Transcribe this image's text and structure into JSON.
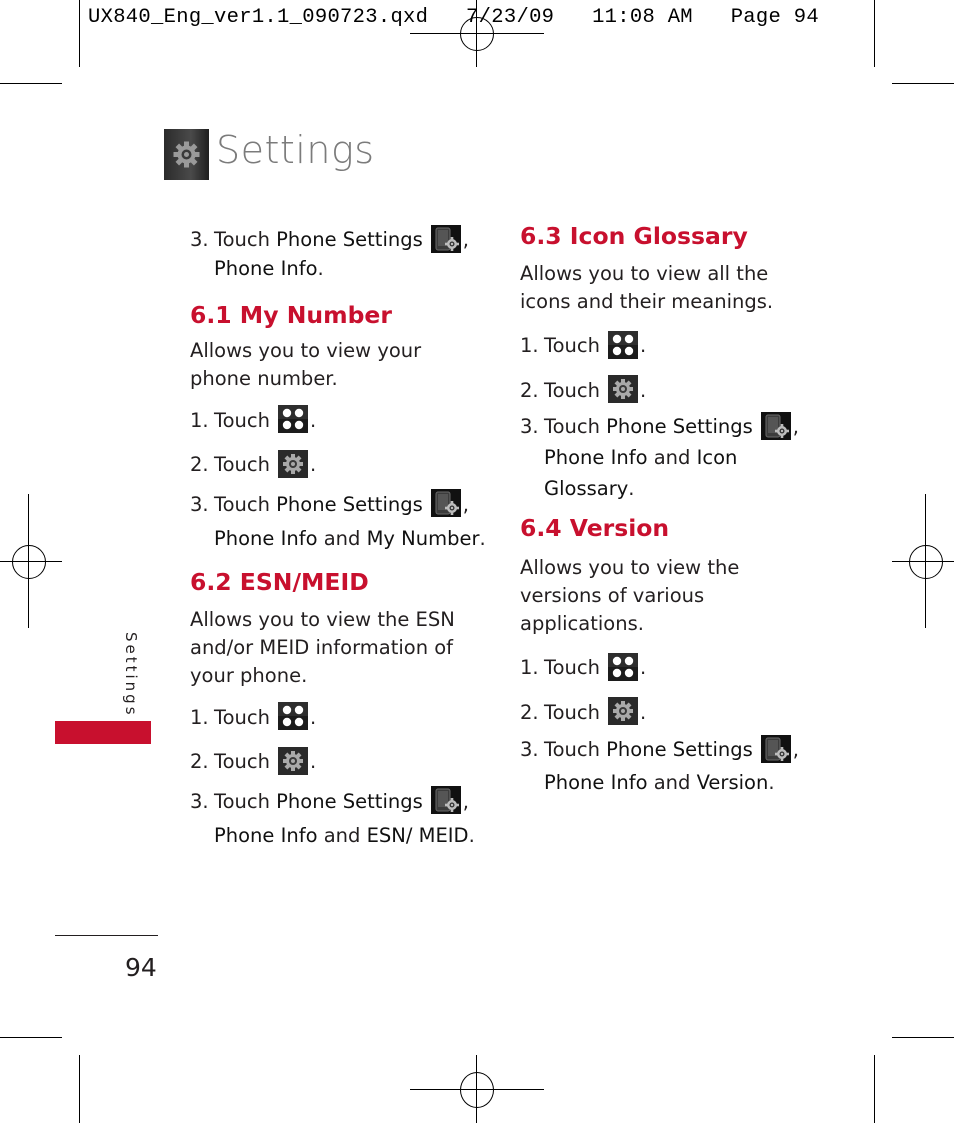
{
  "slug": "UX840_Eng_ver1.1_090723.qxd   7/23/09   11:08 AM   Page 94",
  "header": {
    "icon": "settings-gear-icon",
    "title": "Settings"
  },
  "sidebar": {
    "label": "Settings",
    "accent_color": "#c8102e"
  },
  "page_number": "94",
  "left_column": {
    "intro_step": {
      "num": "3.",
      "touch": "Touch",
      "bold1": "Phone Settings",
      "icon": "phone-settings-icon",
      "comma": ",",
      "bold2": "Phone Info",
      "end": "."
    },
    "sections": [
      {
        "heading": "6.1 My Number",
        "description": "Allows you to view your phone number.",
        "steps": [
          {
            "num": "1.",
            "text": "Touch",
            "icon": "apps-icon",
            "end": "."
          },
          {
            "num": "2.",
            "text": "Touch",
            "icon": "settings-gear-icon",
            "end": "."
          },
          {
            "num": "3.",
            "text": "Touch",
            "bold1": "Phone Settings",
            "icon": "phone-settings-icon",
            "comma": ",",
            "bold2": "Phone Info",
            "and": "and",
            "bold3": "My Number",
            "end": "."
          }
        ]
      },
      {
        "heading": "6.2 ESN/MEID",
        "description": "Allows you to view the ESN and/or MEID information of your phone.",
        "steps": [
          {
            "num": "1.",
            "text": "Touch",
            "icon": "apps-icon",
            "end": "."
          },
          {
            "num": "2.",
            "text": "Touch",
            "icon": "settings-gear-icon",
            "end": "."
          },
          {
            "num": "3.",
            "text": "Touch",
            "bold1": "Phone Settings",
            "icon": "phone-settings-icon",
            "comma": ",",
            "bold2": "Phone Info",
            "and": "and",
            "bold3": "ESN/ MEID",
            "end": "."
          }
        ]
      }
    ]
  },
  "right_column": {
    "sections": [
      {
        "heading": "6.3 Icon Glossary",
        "description": "Allows you to view all the icons and their meanings.",
        "steps": [
          {
            "num": "1.",
            "text": "Touch",
            "icon": "apps-icon",
            "end": "."
          },
          {
            "num": "2.",
            "text": "Touch",
            "icon": "settings-gear-icon",
            "end": "."
          },
          {
            "num": "3.",
            "text": "Touch",
            "bold1": "Phone Settings",
            "icon": "phone-settings-icon",
            "comma": ",",
            "bold2": "Phone Info",
            "and": "and",
            "bold3": "Icon Glossary",
            "end": "."
          }
        ]
      },
      {
        "heading": "6.4 Version",
        "description": "Allows you to view the versions of various applications.",
        "steps": [
          {
            "num": "1.",
            "text": "Touch",
            "icon": "apps-icon",
            "end": "."
          },
          {
            "num": "2.",
            "text": "Touch",
            "icon": "settings-gear-icon",
            "end": "."
          },
          {
            "num": "3.",
            "text": "Touch",
            "bold1": "Phone Settings",
            "icon": "phone-settings-icon",
            "comma": ",",
            "bold2": "Phone Info",
            "and": "and",
            "bold3": "Version",
            "end": "."
          }
        ]
      }
    ]
  }
}
